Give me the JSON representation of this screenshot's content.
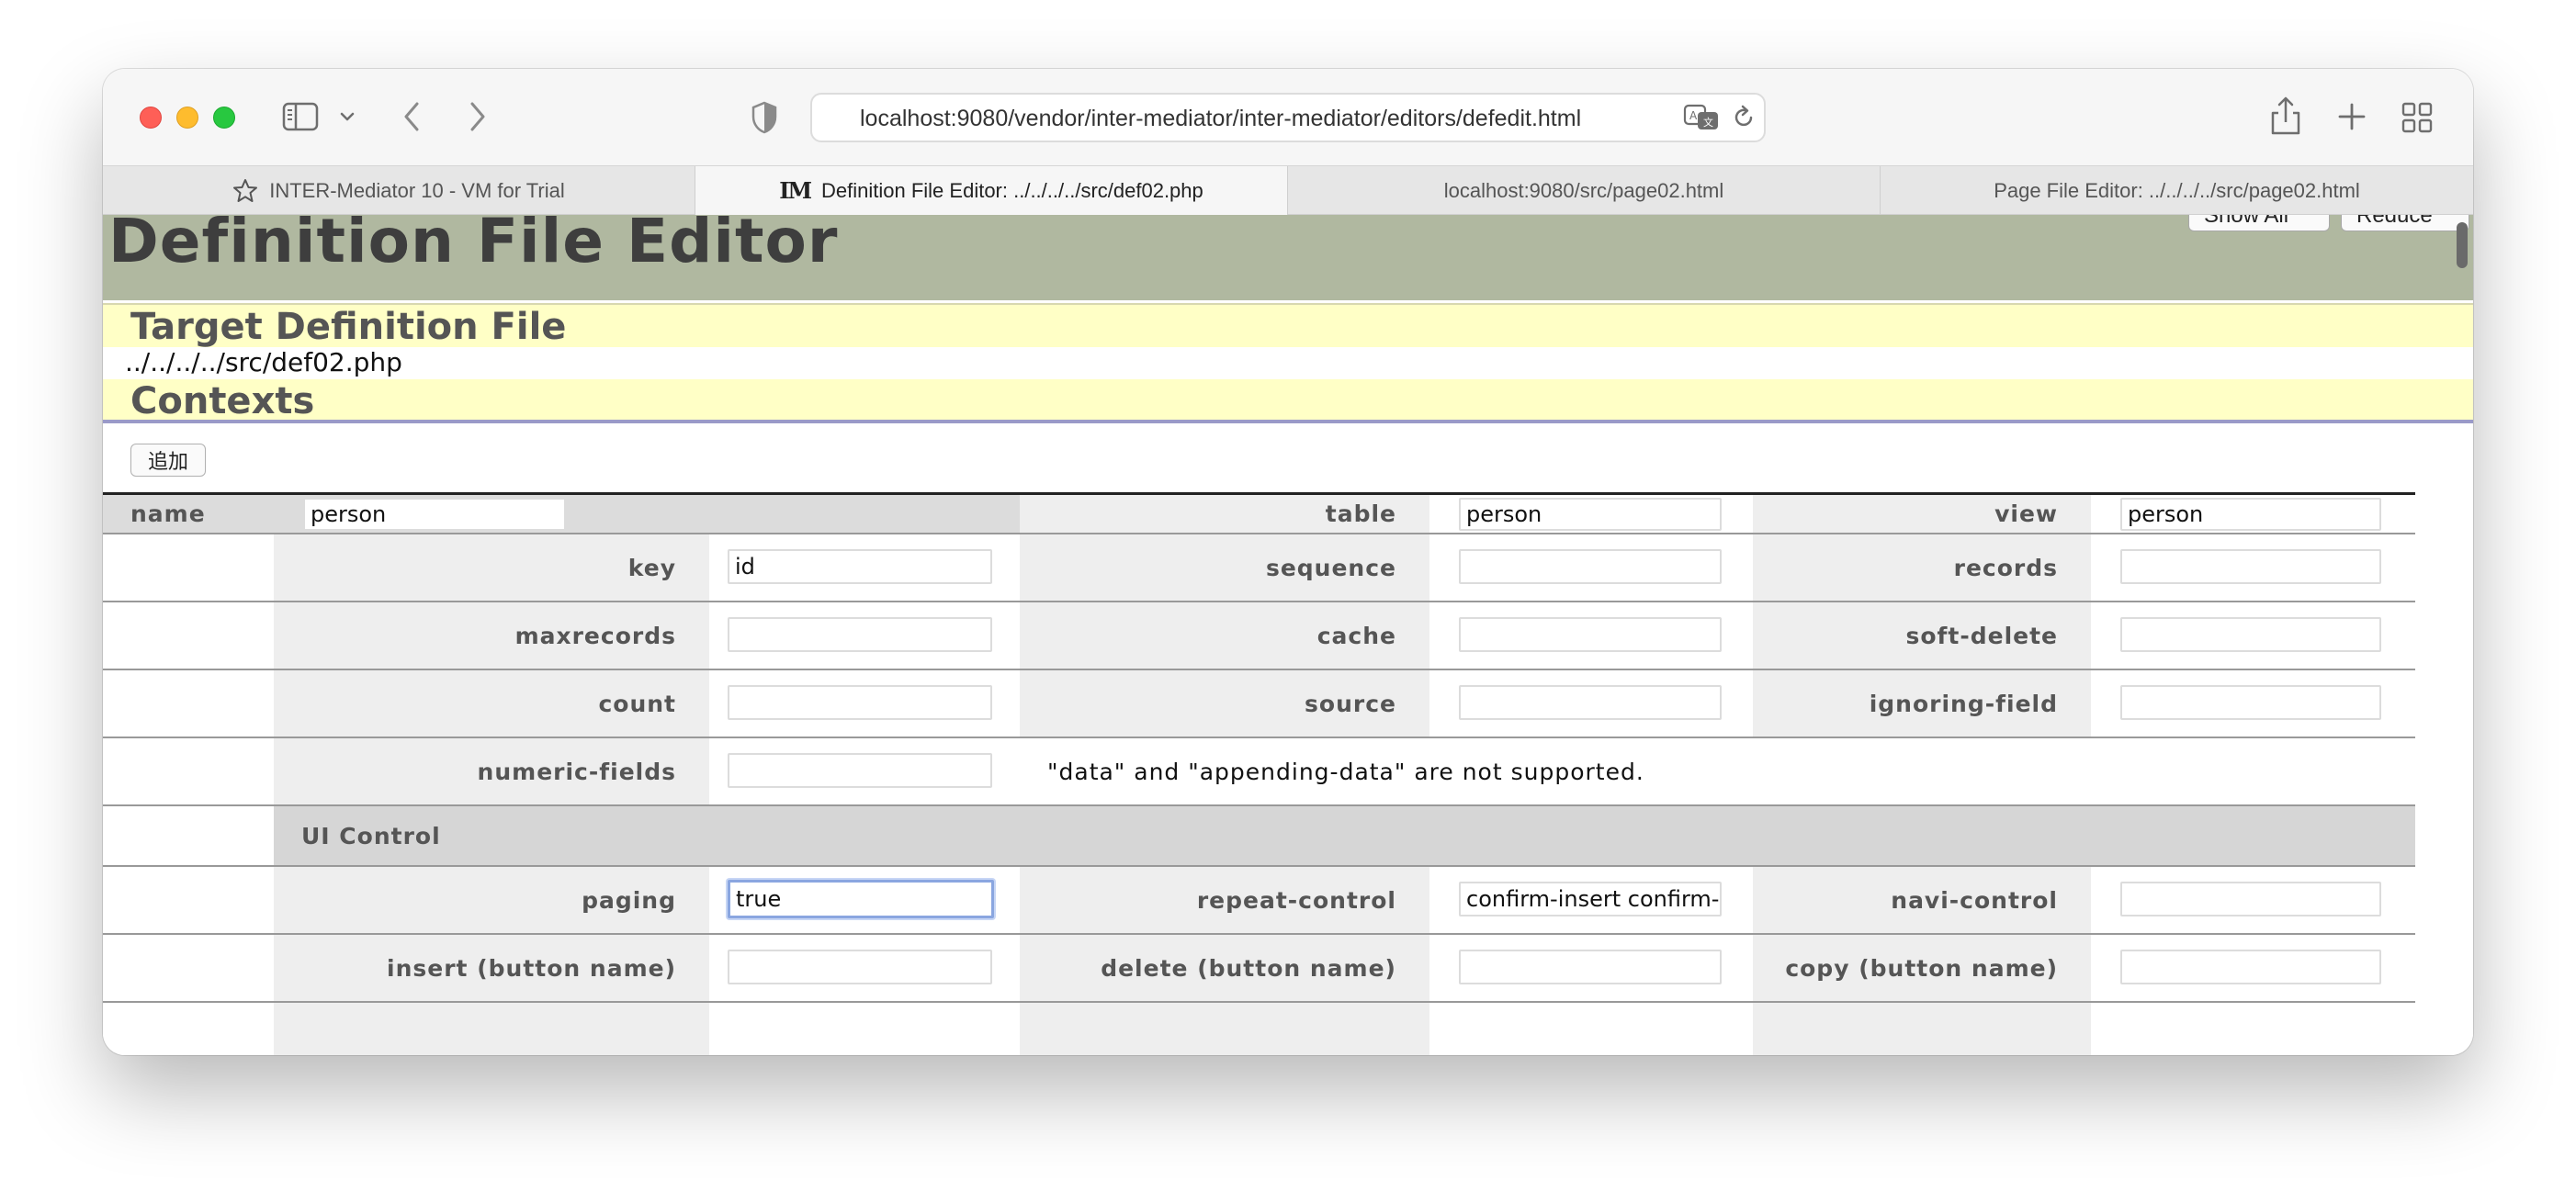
{
  "browser": {
    "url": "localhost:9080/vendor/inter-mediator/inter-mediator/editors/defedit.html",
    "tabs": [
      {
        "label": "INTER-Mediator 10 - VM for Trial",
        "icon": "star-icon"
      },
      {
        "label": "Definition File Editor: ../../../../src/def02.php",
        "icon": "im-logo-icon",
        "icon_text": "IM"
      },
      {
        "label": "localhost:9080/src/page02.html"
      },
      {
        "label": "Page File Editor: ../../../../src/page02.html"
      }
    ]
  },
  "page": {
    "title": "Definition File Editor",
    "show_all_label": "Show All",
    "reduce_label": "Reduce",
    "target_section_title": "Target Definition File",
    "target_path": "../../../../src/def02.php",
    "contexts_section_title": "Contexts",
    "add_button_label": "追加"
  },
  "context": {
    "name": {
      "label": "name",
      "value": "person"
    },
    "table": {
      "label": "table",
      "value": "person"
    },
    "view": {
      "label": "view",
      "value": "person"
    },
    "key": {
      "label": "key",
      "value": "id"
    },
    "sequence": {
      "label": "sequence",
      "value": ""
    },
    "records": {
      "label": "records",
      "value": ""
    },
    "maxrecords": {
      "label": "maxrecords",
      "value": ""
    },
    "cache": {
      "label": "cache",
      "value": ""
    },
    "soft_delete": {
      "label": "soft-delete",
      "value": ""
    },
    "count": {
      "label": "count",
      "value": ""
    },
    "source": {
      "label": "source",
      "value": ""
    },
    "ignoring_field": {
      "label": "ignoring-field",
      "value": ""
    },
    "numeric_fields": {
      "label": "numeric-fields",
      "value": ""
    },
    "unsupported_note": "\"data\" and \"appending-data\" are not supported.",
    "ui_control_title": "UI Control",
    "paging": {
      "label": "paging",
      "value": "true"
    },
    "repeat_control": {
      "label": "repeat-control",
      "value": "confirm-insert confirm-delete"
    },
    "navi_control": {
      "label": "navi-control",
      "value": ""
    },
    "insert_button": {
      "label": "insert (button name)",
      "value": ""
    },
    "delete_button": {
      "label": "delete (button name)",
      "value": ""
    },
    "copy_button": {
      "label": "copy (button name)",
      "value": ""
    }
  }
}
